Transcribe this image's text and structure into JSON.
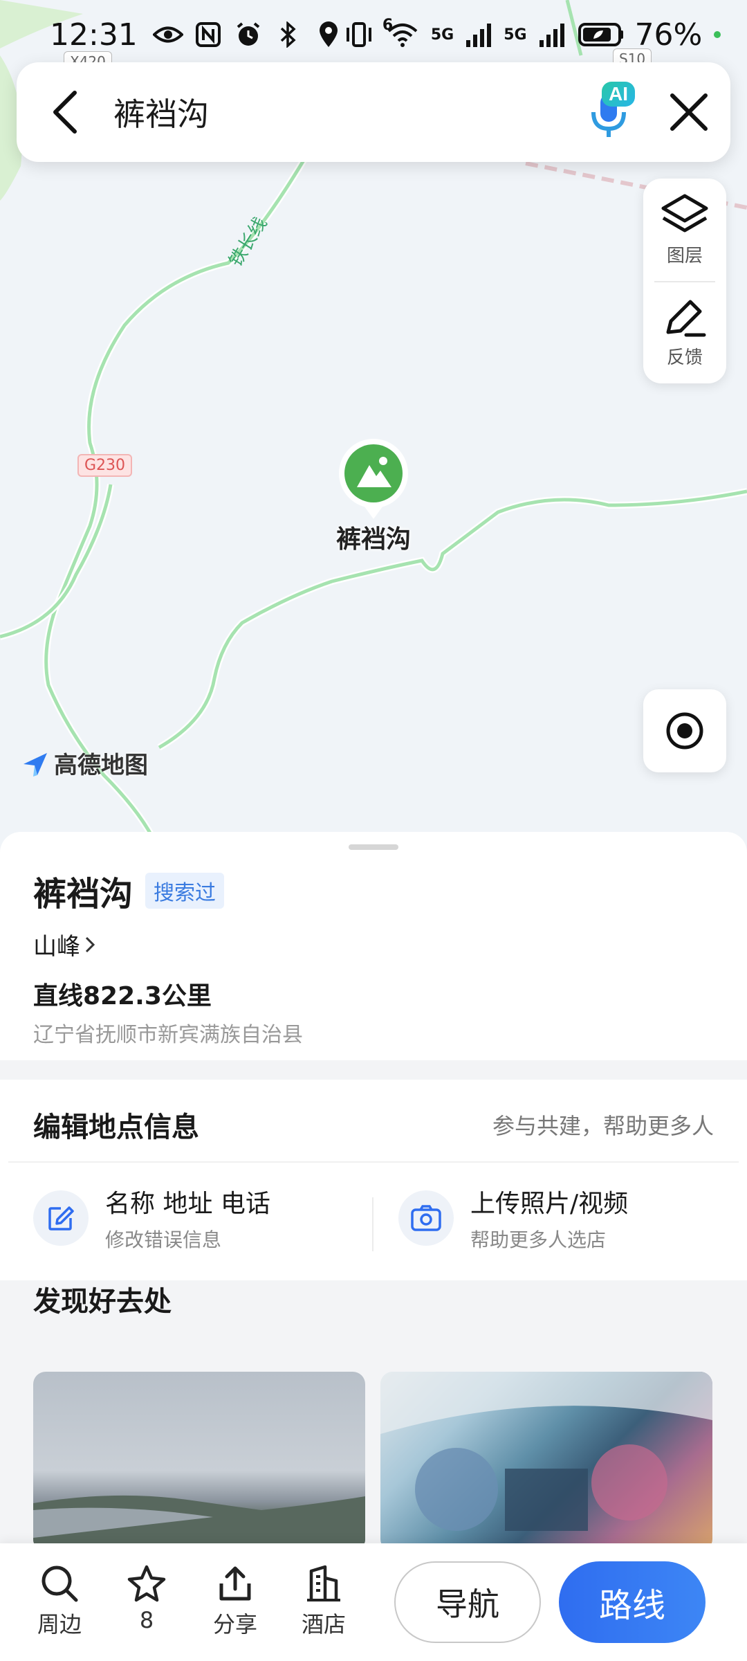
{
  "status_bar": {
    "time": "12:31",
    "signal_label_1": "5G",
    "signal_label_2": "5G",
    "wifi_badge": "6",
    "battery": "76%"
  },
  "search": {
    "query": "裤裆沟",
    "ai_badge": "AI"
  },
  "map_tools": {
    "layers_label": "图层",
    "feedback_label": "反馈"
  },
  "map": {
    "road_tags": [
      "X420",
      "S10",
      "G230"
    ],
    "rail_label": "铁长线",
    "poi_label": "裤裆沟",
    "logo_text": "高德地图",
    "accent_color": "#4caf50"
  },
  "poi": {
    "title": "裤裆沟",
    "tag": "搜索过",
    "category": "山峰",
    "distance": "直线822.3公里",
    "address": "辽宁省抚顺市新宾满族自治县"
  },
  "edit_info": {
    "title": "编辑地点信息",
    "hint": "参与共建，帮助更多人",
    "item1_main": "名称 地址 电话",
    "item1_sub": "修改错误信息",
    "item2_main": "上传照片/视频",
    "item2_sub": "帮助更多人选店"
  },
  "discover": {
    "title": "发现好去处"
  },
  "bottom_bar": {
    "nearby": "周边",
    "favorites_count": "8",
    "share": "分享",
    "hotel": "酒店",
    "navigate": "导航",
    "route": "路线",
    "route_color": "#2f6df0"
  }
}
